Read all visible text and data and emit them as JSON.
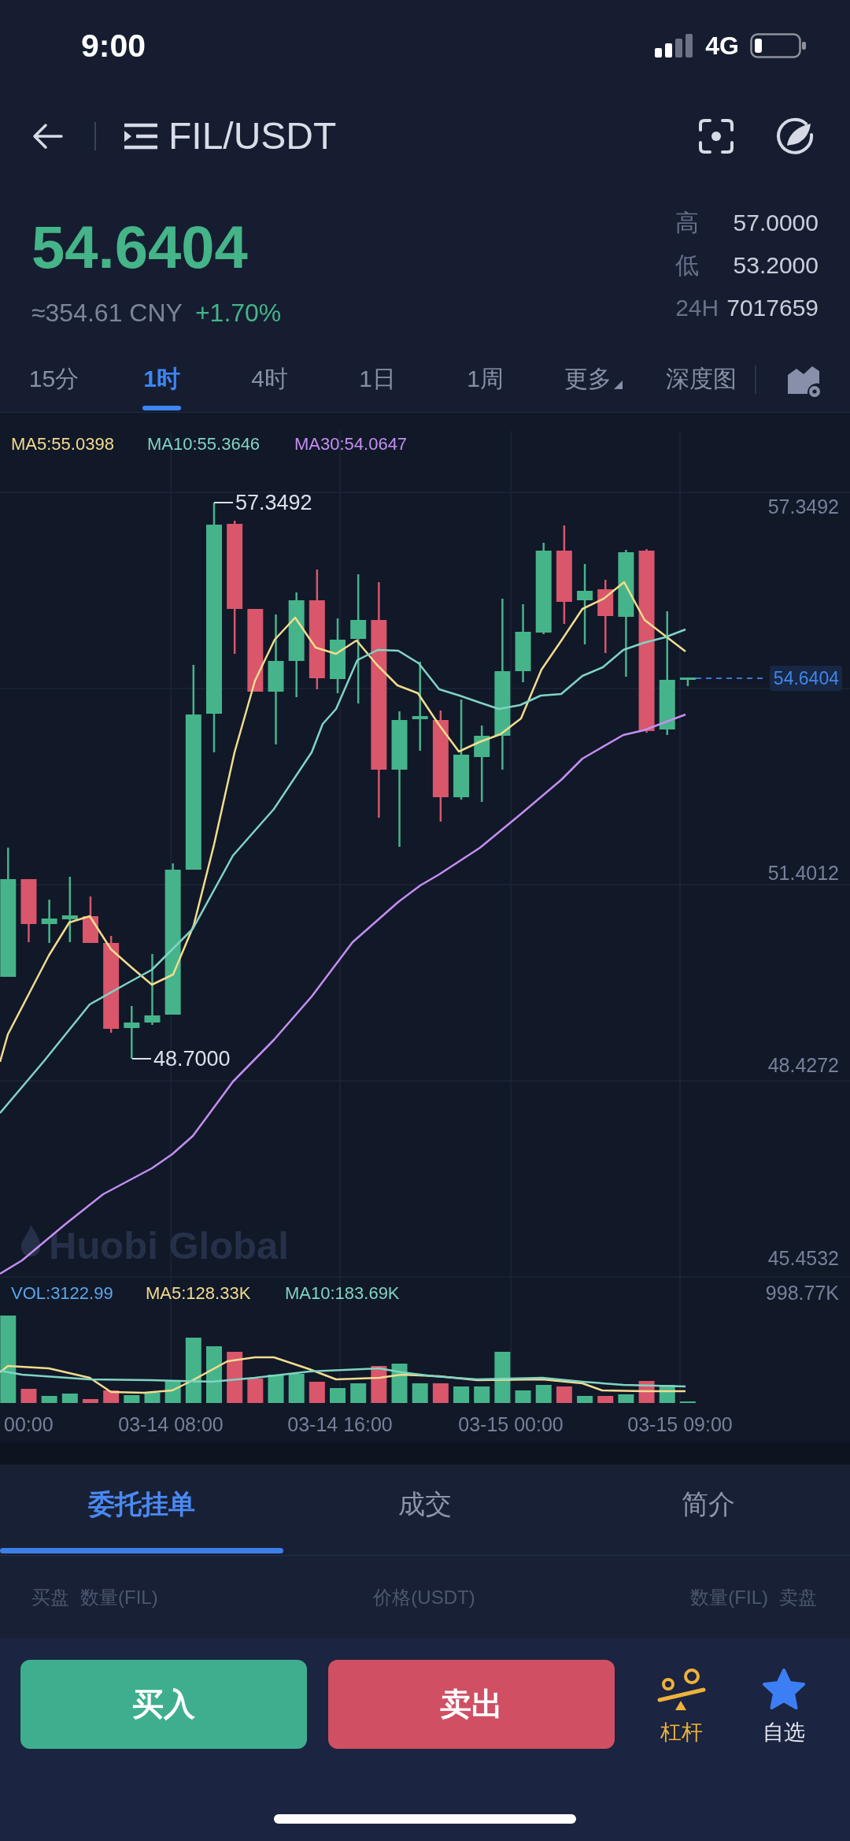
{
  "status_bar": {
    "time": "9:00",
    "network": "4G"
  },
  "header": {
    "title": "FIL/USDT"
  },
  "ticker": {
    "price": "54.6404",
    "cny_price": "≈354.61 CNY",
    "change": "+1.70%",
    "stats": [
      {
        "label": "高",
        "value": "57.0000"
      },
      {
        "label": "低",
        "value": "53.2000"
      },
      {
        "label": "24H",
        "value": "7017659"
      }
    ]
  },
  "intervals": [
    {
      "label": "15分",
      "kind": "tab",
      "selected": false
    },
    {
      "label": "1时",
      "kind": "tab",
      "selected": true
    },
    {
      "label": "4时",
      "kind": "tab",
      "selected": false
    },
    {
      "label": "1日",
      "kind": "tab",
      "selected": false
    },
    {
      "label": "1周",
      "kind": "tab",
      "selected": false
    },
    {
      "label": "更多",
      "kind": "dropdown",
      "selected": false
    },
    {
      "label": "深度图",
      "kind": "tab",
      "selected": false
    }
  ],
  "chart": {
    "legend": [
      {
        "label": "MA5:55.0398",
        "color": "#f3dc8e"
      },
      {
        "label": "MA10:55.3646",
        "color": "#80d4c4"
      },
      {
        "label": "MA30:54.0647",
        "color": "#c58ef2"
      }
    ],
    "price_axis": [
      "57.3492",
      "51.4012",
      "48.4272",
      "45.4532"
    ],
    "last_price": "54.6404",
    "high_label": "57.3492",
    "low_label": "48.7000",
    "watermark": "Huobi Global"
  },
  "volume": {
    "legend": [
      {
        "label": "VOL:3122.99",
        "color": "#5ba7ea"
      },
      {
        "label": "MA5:128.33K",
        "color": "#f3dc8e"
      },
      {
        "label": "MA10:183.69K",
        "color": "#80d4c4"
      }
    ],
    "axis_max": "998.77K"
  },
  "time_axis": [
    "00:00",
    "03-14 08:00",
    "03-14 16:00",
    "03-15 00:00",
    "03-15 09:00"
  ],
  "panel_tabs": [
    {
      "label": "委托挂单",
      "selected": true
    },
    {
      "label": "成交",
      "selected": false
    },
    {
      "label": "简介",
      "selected": false
    }
  ],
  "order_book": {
    "buy_side": "买盘",
    "buy_amount": "数量(FIL)",
    "price": "价格(USDT)",
    "sell_amount": "数量(FIL)",
    "sell_side": "卖盘"
  },
  "actions": {
    "buy": "买入",
    "sell": "卖出"
  },
  "shortcuts": [
    {
      "label": "杠杆",
      "kind": "leverage"
    },
    {
      "label": "自选",
      "kind": "favorite"
    }
  ]
}
